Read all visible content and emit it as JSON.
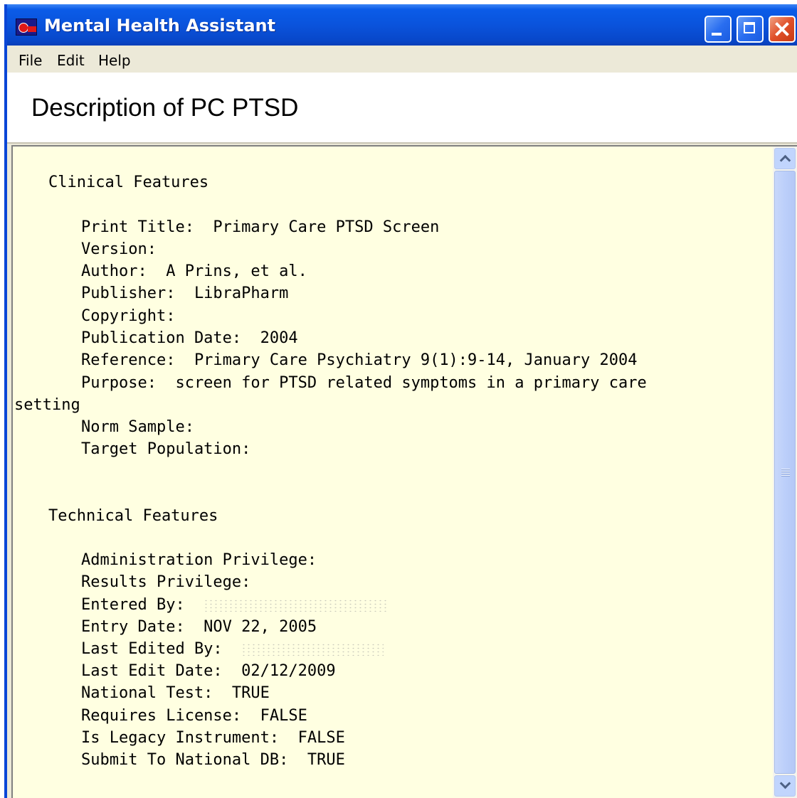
{
  "window": {
    "title": "Mental Health Assistant",
    "icon": "app-icon"
  },
  "menu": {
    "file": "File",
    "edit": "Edit",
    "help": "Help"
  },
  "page": {
    "title": "Description of PC PTSD"
  },
  "clinical": {
    "heading": "Clinical Features",
    "print_title": "Print Title:  Primary Care PTSD Screen",
    "version": "Version:",
    "author": "Author:  A Prins, et al.",
    "publisher": "Publisher:  LibraPharm",
    "copyright": "Copyright:",
    "publication_date": "Publication Date:  2004",
    "reference": "Reference:  Primary Care Psychiatry 9(1):9-14, January 2004",
    "purpose": "Purpose:  screen for PTSD related symptoms in a primary care",
    "purpose_wrap": "setting",
    "norm_sample": "Norm Sample:",
    "target_population": "Target Population:"
  },
  "technical": {
    "heading": "Technical Features",
    "administration_privilege": "Administration Privilege:",
    "results_privilege": "Results Privilege:",
    "entered_by": "Entered By:  ",
    "entry_date": "Entry Date:  NOV 22, 2005",
    "last_edited_by": "Last Edited By:  ",
    "last_edit_date": "Last Edit Date:  02/12/2009",
    "national_test": "National Test:  TRUE",
    "requires_license": "Requires License:  FALSE",
    "is_legacy_instrument": "Is Legacy Instrument:  FALSE",
    "submit_to_national_db": "Submit To National DB:  TRUE"
  },
  "colors": {
    "titlebar": "#0a53dc",
    "content_background": "#ffffe1",
    "chrome": "#ece9d8"
  }
}
